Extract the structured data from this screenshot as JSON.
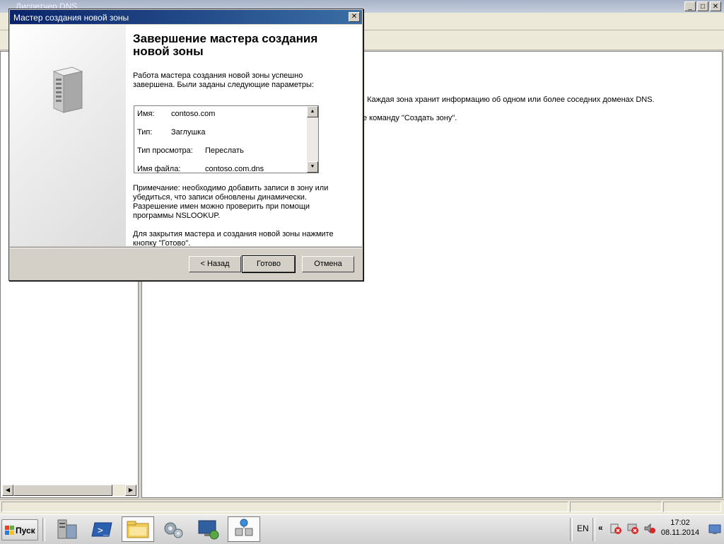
{
  "app": {
    "title": "Диспетчер DNS",
    "window_controls": {
      "minimize": "_",
      "maximize": "□",
      "close": "✕"
    }
  },
  "right_pane": {
    "line1": ". Каждая зона хранит информацию об одном или более соседних доменах DNS.",
    "line2": "е команду \"Создать зону\"."
  },
  "wizard": {
    "title": "Мастер создания новой зоны",
    "close_glyph": "✕",
    "heading": "Завершение мастера создания новой зоны",
    "intro": "Работа мастера создания новой зоны успешно завершена. Были заданы следующие параметры:",
    "summary": [
      {
        "key": "Имя:",
        "value": "contoso.com"
      },
      {
        "key": "Тип:",
        "value": "Заглушка"
      },
      {
        "key": "Тип просмотра:",
        "value": "Переслать"
      },
      {
        "key": "Имя файла:",
        "value": "contoso.com.dns"
      }
    ],
    "note": "Примечание: необходимо добавить записи в зону или убедиться, что записи обновлены динамически. Разрешение имен можно проверить при помощи программы NSLOOKUP.",
    "finish_text": "Для закрытия мастера и создания новой зоны нажмите кнопку \"Готово\".",
    "buttons": {
      "back": "< Назад",
      "finish": "Готово",
      "cancel": "Отмена"
    }
  },
  "taskbar": {
    "start_label": "Пуск",
    "language": "EN",
    "tray_expand": "«",
    "clock_time": "17:02",
    "clock_date": "08.11.2014"
  },
  "colors": {
    "wizard_title_start": "#0a246a",
    "wizard_title_end": "#3a6ea5",
    "dialog_face": "#d4d0c8"
  }
}
